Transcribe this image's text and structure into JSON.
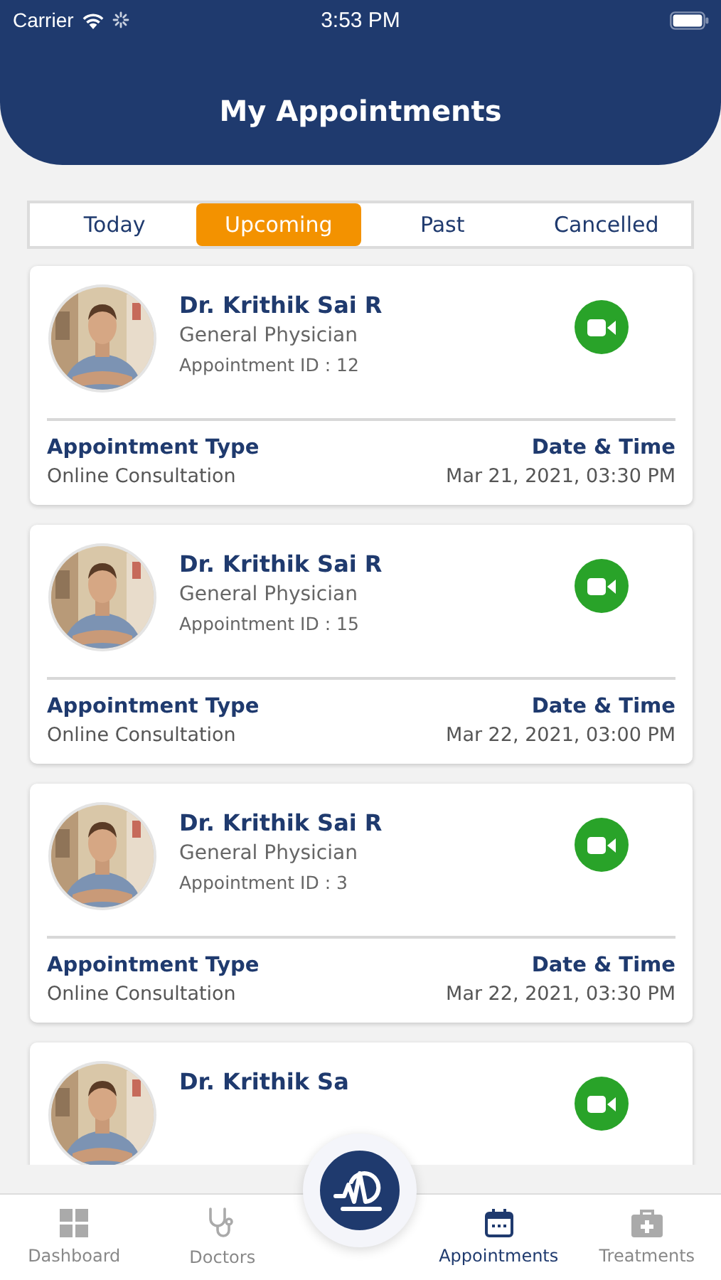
{
  "status_bar": {
    "carrier": "Carrier",
    "time": "3:53 PM"
  },
  "header": {
    "title": "My Appointments"
  },
  "tabs": [
    {
      "label": "Today",
      "selected": false
    },
    {
      "label": "Upcoming",
      "selected": true
    },
    {
      "label": "Past",
      "selected": false
    },
    {
      "label": "Cancelled",
      "selected": false
    }
  ],
  "appointments": [
    {
      "doctor": "Dr. Krithik Sai R",
      "specialty": "General Physician",
      "appointment_id": "Appointment ID : 12",
      "type_label": "Appointment Type",
      "type": "Online Consultation",
      "datetime_label": "Date & Time",
      "datetime": "Mar 21, 2021, 03:30 PM"
    },
    {
      "doctor": "Dr. Krithik Sai R",
      "specialty": "General Physician",
      "appointment_id": "Appointment ID : 15",
      "type_label": "Appointment Type",
      "type": "Online Consultation",
      "datetime_label": "Date & Time",
      "datetime": "Mar 22, 2021, 03:00 PM"
    },
    {
      "doctor": "Dr. Krithik Sai R",
      "specialty": "General Physician",
      "appointment_id": "Appointment ID : 3",
      "type_label": "Appointment Type",
      "type": "Online Consultation",
      "datetime_label": "Date & Time",
      "datetime": "Mar 22, 2021, 03:30 PM"
    },
    {
      "doctor": "Dr. Krithik Sa"
    }
  ],
  "nav": [
    {
      "kind": "grid",
      "label": "Dashboard",
      "selected": false
    },
    {
      "kind": "stethoscope",
      "label": "Doctors",
      "selected": false
    },
    {
      "kind": "calendar",
      "label": "Appointments",
      "selected": true
    },
    {
      "kind": "kit",
      "label": "Treatments",
      "selected": false
    }
  ]
}
